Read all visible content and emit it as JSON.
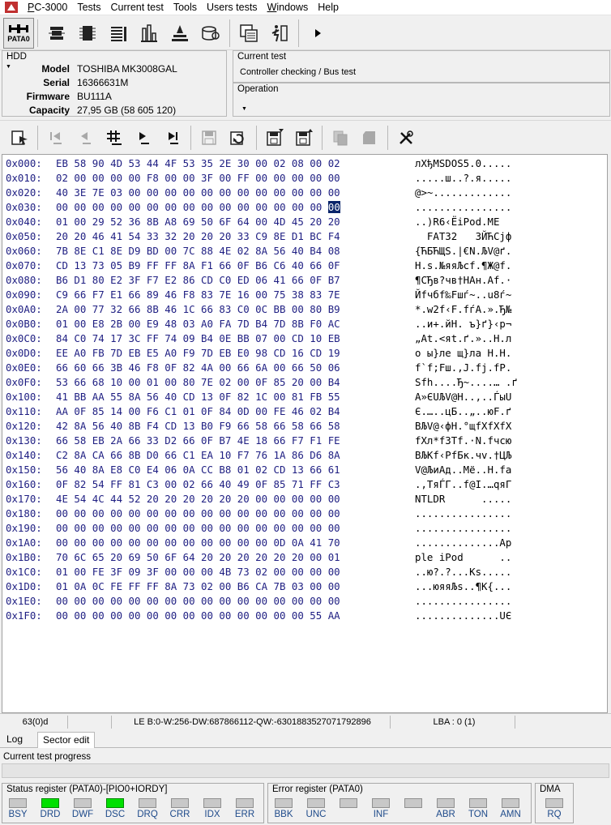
{
  "menu": {
    "items": [
      "PC-3000",
      "Tests",
      "Current test",
      "Tools",
      "Users tests",
      "Windows",
      "Help"
    ]
  },
  "toolbar": {
    "port_label": "PATA0",
    "icons": [
      "pata0-icon",
      "hdd-chip-icon",
      "module-icon",
      "list-icon",
      "chart-icon",
      "sprayer-icon",
      "disk-icon",
      "copy-windows-icon",
      "run-icon",
      "book-icon",
      "play-icon"
    ]
  },
  "hdd": {
    "title": "HDD",
    "fields": [
      {
        "key": "Model",
        "value": "TOSHIBA MK3008GAL"
      },
      {
        "key": "Serial",
        "value": "16366631M"
      },
      {
        "key": "Firmware",
        "value": "BU111A"
      },
      {
        "key": "Capacity",
        "value": "27,95 GB (58 605 120)"
      }
    ]
  },
  "current_test": {
    "title": "Current test",
    "value": "Controller checking / Bus test"
  },
  "operation": {
    "title": "Operation",
    "value": ""
  },
  "hex": {
    "cursor_row": 3,
    "cursor_col": 15,
    "rows": [
      {
        "off": "0x000:",
        "bytes": "EB 58 90 4D 53 44 4F 53 35 2E 30 00 02 08 00 02",
        "ascii": "лXђMSDOS5.0....."
      },
      {
        "off": "0x010:",
        "bytes": "02 00 00 00 00 F8 00 00 3F 00 FF 00 00 00 00 00",
        "ascii": ".....ш..?.я....."
      },
      {
        "off": "0x020:",
        "bytes": "40 3E 7E 03 00 00 00 00 00 00 00 00 00 00 00 00",
        "ascii": "@>~............."
      },
      {
        "off": "0x030:",
        "bytes": "00 00 00 00 00 00 00 00 00 00 00 00 00 00 00 00",
        "ascii": "................"
      },
      {
        "off": "0x040:",
        "bytes": "01 00 29 52 36 8B A8 69 50 6F 64 00 4D 45 20 20",
        "ascii": "..)R6‹ЁiPod.ME  "
      },
      {
        "off": "0x050:",
        "bytes": "20 20 46 41 54 33 32 20 20 20 33 C9 8E D1 BC F4",
        "ascii": "  FAT32   3ЙЋСјф"
      },
      {
        "off": "0x060:",
        "bytes": "7B 8E C1 8E D9 BD 00 7C 88 4E 02 8A 56 40 B4 08",
        "ascii": "{ЋБЋЩЅ.|€N.ЉV@ґ."
      },
      {
        "off": "0x070:",
        "bytes": "CD 13 73 05 B9 FF FF 8A F1 66 0F B6 C6 40 66 0F",
        "ascii": "Н.s.№яяЉсf.¶Ж@f."
      },
      {
        "off": "0x080:",
        "bytes": "B6 D1 80 E2 3F F7 E2 86 CD C0 ED 06 41 66 0F B7",
        "ascii": "¶СЂв?чв†НАн.Af.·"
      },
      {
        "off": "0x090:",
        "bytes": "C9 66 F7 E1 66 89 46 F8 83 7E 16 00 75 38 83 7E",
        "ascii": "Йfчбf‰Fшѓ~..u8ѓ~"
      },
      {
        "off": "0x0A0:",
        "bytes": "2A 00 77 32 66 8B 46 1C 66 83 C0 0C BB 00 80 B9",
        "ascii": "*.w2f‹F.fѓА.».Ђ№"
      },
      {
        "off": "0x0B0:",
        "bytes": "01 00 E8 2B 00 E9 48 03 A0 FA 7D B4 7D 8B F0 AC",
        "ascii": "..и+.йH. ъ}ґ}‹р¬"
      },
      {
        "off": "0x0C0:",
        "bytes": "84 C0 74 17 3C FF 74 09 B4 0E BB 07 00 CD 10 EB",
        "ascii": "„Аt.<яt.ґ.»..Н.л"
      },
      {
        "off": "0x0D0:",
        "bytes": "EE A0 FB 7D EB E5 A0 F9 7D EB E0 98 CD 16 CD 19",
        "ascii": "о ы}ле щ}ла Н.Н."
      },
      {
        "off": "0x0E0:",
        "bytes": "66 60 66 3B 46 F8 0F 82 4A 00 66 6A 00 66 50 06",
        "ascii": "f`f;Fш.‚J.fj.fP."
      },
      {
        "off": "0x0F0:",
        "bytes": "53 66 68 10 00 01 00 80 7E 02 00 0F 85 20 00 B4",
        "ascii": "Sfh....Ђ~....… .ґ"
      },
      {
        "off": "0x100:",
        "bytes": "41 BB AA 55 8A 56 40 CD 13 0F 82 1C 00 81 FB 55",
        "ascii": "A»ЄUЉV@Н..‚..ЃыU"
      },
      {
        "off": "0x110:",
        "bytes": "AA 0F 85 14 00 F6 C1 01 0F 84 0D 00 FE 46 02 B4",
        "ascii": "Є.…..цБ..„..юF.ґ"
      },
      {
        "off": "0x120:",
        "bytes": "42 8A 56 40 8B F4 CD 13 B0 F9 66 58 66 58 66 58",
        "ascii": "BЉV@‹фН.°щfXfXfX"
      },
      {
        "off": "0x130:",
        "bytes": "66 58 EB 2A 66 33 D2 66 0F B7 4E 18 66 F7 F1 FE",
        "ascii": "fXл*f3Тf.·N.fчсю"
      },
      {
        "off": "0x140:",
        "bytes": "C2 8A CA 66 8B D0 66 C1 EA 10 F7 76 1A 86 D6 8A",
        "ascii": "ВЉКf‹РfБк.чv.†ЦЉ"
      },
      {
        "off": "0x150:",
        "bytes": "56 40 8A E8 C0 E4 06 0A CC B8 01 02 CD 13 66 61",
        "ascii": "V@ЉиАд..Мё..Н.fa"
      },
      {
        "off": "0x160:",
        "bytes": "0F 82 54 FF 81 C3 00 02 66 40 49 0F 85 71 FF C3",
        "ascii": ".‚TяЃГ..f@I.…qяГ"
      },
      {
        "off": "0x170:",
        "bytes": "4E 54 4C 44 52 20 20 20 20 20 20 00 00 00 00 00",
        "ascii": "NTLDR      ....."
      },
      {
        "off": "0x180:",
        "bytes": "00 00 00 00 00 00 00 00 00 00 00 00 00 00 00 00",
        "ascii": "................"
      },
      {
        "off": "0x190:",
        "bytes": "00 00 00 00 00 00 00 00 00 00 00 00 00 00 00 00",
        "ascii": "................"
      },
      {
        "off": "0x1A0:",
        "bytes": "00 00 00 00 00 00 00 00 00 00 00 00 0D 0A 41 70",
        "ascii": "..............Ap"
      },
      {
        "off": "0x1B0:",
        "bytes": "70 6C 65 20 69 50 6F 64 20 20 20 20 20 20 00 01",
        "ascii": "ple iPod      .."
      },
      {
        "off": "0x1C0:",
        "bytes": "01 00 FE 3F 09 3F 00 00 00 4B 73 02 00 00 00 00",
        "ascii": "..ю?.?...Ks....."
      },
      {
        "off": "0x1D0:",
        "bytes": "01 0A 0C FE FF FF 8A 73 02 00 B6 CA 7B 03 00 00",
        "ascii": "...юяяЉs..¶К{..."
      },
      {
        "off": "0x1E0:",
        "bytes": "00 00 00 00 00 00 00 00 00 00 00 00 00 00 00 00",
        "ascii": "................"
      },
      {
        "off": "0x1F0:",
        "bytes": "00 00 00 00 00 00 00 00 00 00 00 00 00 00 55 AA",
        "ascii": "..............UЄ"
      }
    ]
  },
  "statusbar": {
    "pos": "63(0)d",
    "le": "LE B:0-W:256-DW:687866112-QW:-6301883527071792896",
    "lba": "LBA : 0 (1)"
  },
  "tabs": {
    "log": "Log",
    "sector_edit": "Sector edit"
  },
  "progress": {
    "label": "Current test progress",
    "value": 0
  },
  "status_register": {
    "title": "Status register (PATA0)-[PIO0+IORDY]",
    "bits": [
      {
        "name": "BSY",
        "on": false
      },
      {
        "name": "DRD",
        "on": true
      },
      {
        "name": "DWF",
        "on": false
      },
      {
        "name": "DSC",
        "on": true
      },
      {
        "name": "DRQ",
        "on": false
      },
      {
        "name": "CRR",
        "on": false
      },
      {
        "name": "IDX",
        "on": false
      },
      {
        "name": "ERR",
        "on": false
      }
    ]
  },
  "error_register": {
    "title": "Error register (PATA0)",
    "bits": [
      {
        "name": "BBK",
        "on": false
      },
      {
        "name": "UNC",
        "on": false
      },
      {
        "name": "",
        "on": false
      },
      {
        "name": "INF",
        "on": false
      },
      {
        "name": "",
        "on": false
      },
      {
        "name": "ABR",
        "on": false
      },
      {
        "name": "TON",
        "on": false
      },
      {
        "name": "AMN",
        "on": false
      }
    ]
  },
  "dma": {
    "title": "DMA",
    "bits": [
      {
        "name": "RQ",
        "on": false
      }
    ]
  },
  "colors": {
    "led_on": "#00e000",
    "led_off": "#c8c8c8",
    "hex_text": "#1e1e82",
    "cursor_bg": "#0a246a"
  }
}
